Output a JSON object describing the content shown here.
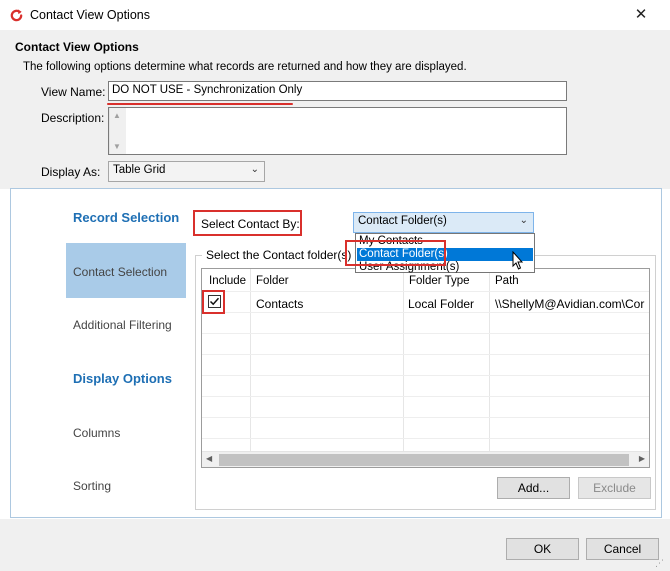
{
  "window": {
    "title": "Contact View Options",
    "close_glyph": "✕"
  },
  "header": {
    "title": "Contact View Options",
    "description": "The following options determine what records are returned and how they are displayed."
  },
  "form": {
    "view_name_label": "View Name:",
    "view_name_value": "DO NOT USE - Synchronization Only",
    "description_label": "Description:",
    "description_value": "",
    "display_as_label": "Display As:",
    "display_as_value": "Table Grid"
  },
  "nav": {
    "record_selection_header": "Record Selection",
    "items_record": [
      "Contact Selection",
      "Additional Filtering"
    ],
    "display_options_header": "Display Options",
    "items_display": [
      "Columns",
      "Sorting"
    ],
    "selected": "Contact Selection"
  },
  "selection": {
    "select_by_label": "Select Contact By:",
    "select_by_value": "Contact Folder(s)",
    "dropdown_options": [
      "My Contacts",
      "Contact Folder(s)",
      "User Assignment(s)"
    ],
    "dropdown_selected_index": 1,
    "group_title": "Select the Contact folder(s) t"
  },
  "table": {
    "columns": [
      "Include",
      "Folder",
      "Folder Type",
      "Path"
    ],
    "rows": [
      {
        "include": true,
        "folder": "Contacts",
        "folder_type": "Local Folder",
        "path": "\\\\ShellyM@Avidian.com\\Cor"
      }
    ]
  },
  "buttons": {
    "add": "Add...",
    "exclude": "Exclude",
    "ok": "OK",
    "cancel": "Cancel"
  },
  "icons": {
    "app": "refresh-arrow-icon",
    "check": "checkmark-icon",
    "cursor": "mouse-pointer-icon"
  },
  "colors": {
    "accent": "#1e6fb4",
    "nav_selected": "#a9cbe8",
    "highlight": "#0078d7",
    "annotation_red": "#d9302c"
  }
}
